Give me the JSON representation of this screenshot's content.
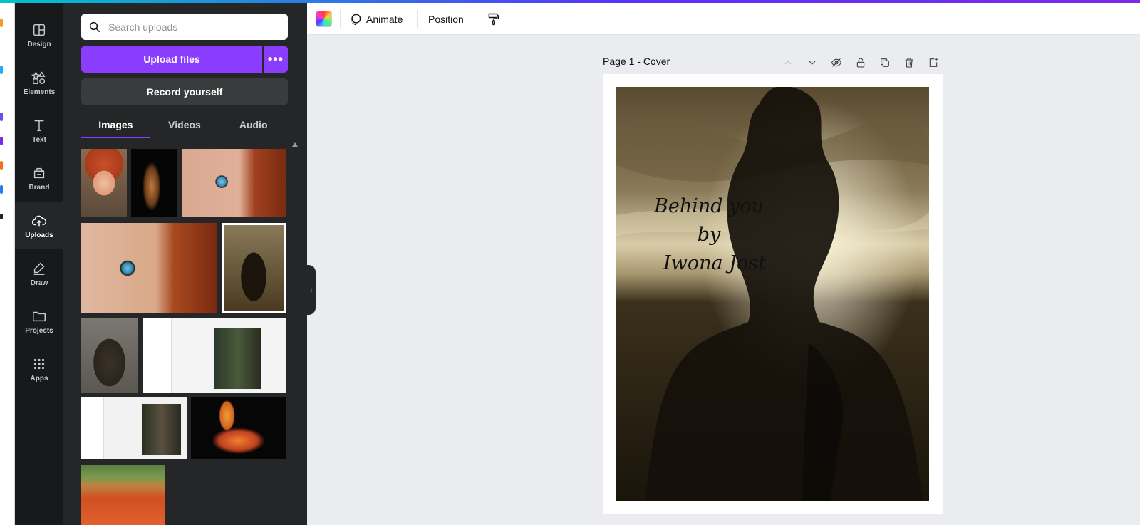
{
  "rail": {
    "items": [
      {
        "label": "Design",
        "icon": "layout-icon"
      },
      {
        "label": "Elements",
        "icon": "shapes-icon"
      },
      {
        "label": "Text",
        "icon": "text-icon"
      },
      {
        "label": "Brand",
        "icon": "brand-icon"
      },
      {
        "label": "Uploads",
        "icon": "cloud-upload-icon",
        "active": true
      },
      {
        "label": "Draw",
        "icon": "pen-icon"
      },
      {
        "label": "Projects",
        "icon": "folder-icon"
      },
      {
        "label": "Apps",
        "icon": "apps-grid-icon"
      }
    ]
  },
  "uploads_panel": {
    "search_placeholder": "Search uploads",
    "upload_label": "Upload files",
    "more_label": "•••",
    "record_label": "Record yourself",
    "tabs": [
      {
        "label": "Images",
        "active": true
      },
      {
        "label": "Videos"
      },
      {
        "label": "Audio"
      }
    ]
  },
  "toolbar": {
    "animate_label": "Animate",
    "position_label": "Position"
  },
  "page": {
    "title": "Page 1 - Cover",
    "cover_lines": [
      "Behind you",
      "by",
      "Iwona Jost"
    ]
  },
  "colors": {
    "accent": "#8b3dff",
    "rail_bg": "#18191b",
    "panel_bg": "#252627",
    "canvas_bg": "#ebecf0"
  }
}
